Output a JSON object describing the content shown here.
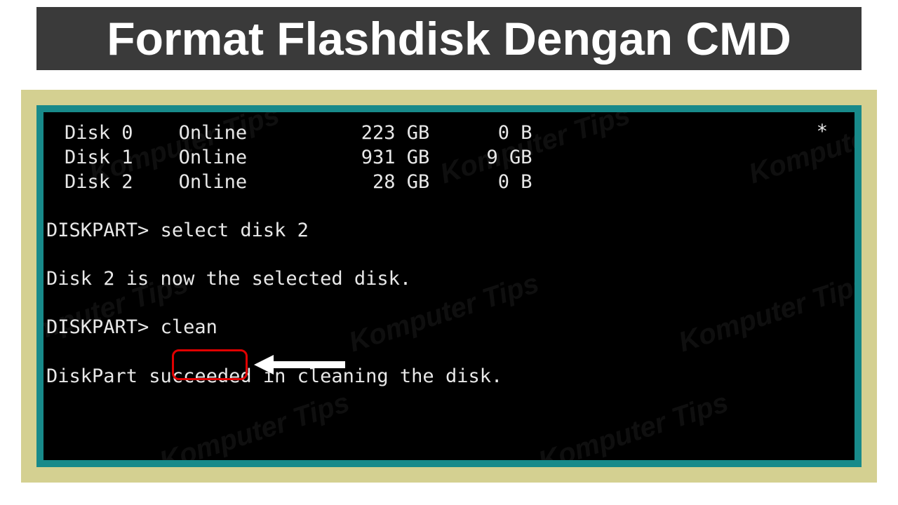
{
  "title": "Format Flashdisk Dengan CMD",
  "watermark_text": "Komputer Tips",
  "terminal": {
    "disks": [
      {
        "name": "Disk 0",
        "status": "Online",
        "size": "223 GB",
        "free": "0 B",
        "gpt": "*"
      },
      {
        "name": "Disk 1",
        "status": "Online",
        "size": "931 GB",
        "free": "9 GB",
        "gpt": ""
      },
      {
        "name": "Disk 2",
        "status": "Online",
        "size": "28 GB",
        "free": "0 B",
        "gpt": ""
      }
    ],
    "prompt": "DISKPART>",
    "command1": "select disk 2",
    "response1": "Disk 2 is now the selected disk.",
    "command2": "clean",
    "response2": "DiskPart succeeded in cleaning the disk."
  }
}
